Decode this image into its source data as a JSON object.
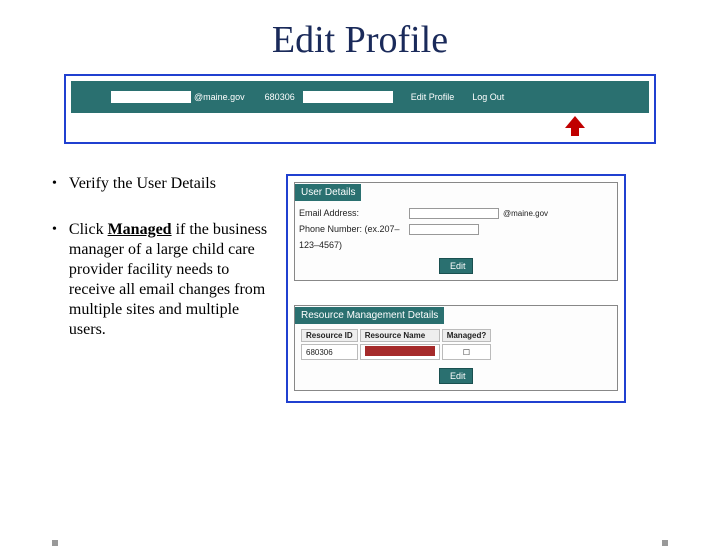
{
  "title": "Edit Profile",
  "header": {
    "mail_suffix": "@maine.gov",
    "id": "680306",
    "link_edit": "Edit Profile",
    "link_logout": "Log Out"
  },
  "bullets": {
    "b1": "Verify the User Details",
    "b2_pre": "Click ",
    "b2_bold": "Managed",
    "b2_post": " if the business manager of a large child care provider facility needs to receive all email changes from multiple sites and multiple users."
  },
  "user_details": {
    "panel_title": "User Details",
    "email_label": "Email Address:",
    "email_suffix": "@maine.gov",
    "phone_label": "Phone Number: (ex.207–",
    "phone_hint": "123–4567)",
    "edit_btn": "Edit"
  },
  "resource": {
    "panel_title": "Resource Management Details",
    "col_id": "Resource ID",
    "col_name": "Resource Name",
    "col_mgd": "Managed?",
    "row_id": "680306",
    "edit_btn": "Edit"
  }
}
